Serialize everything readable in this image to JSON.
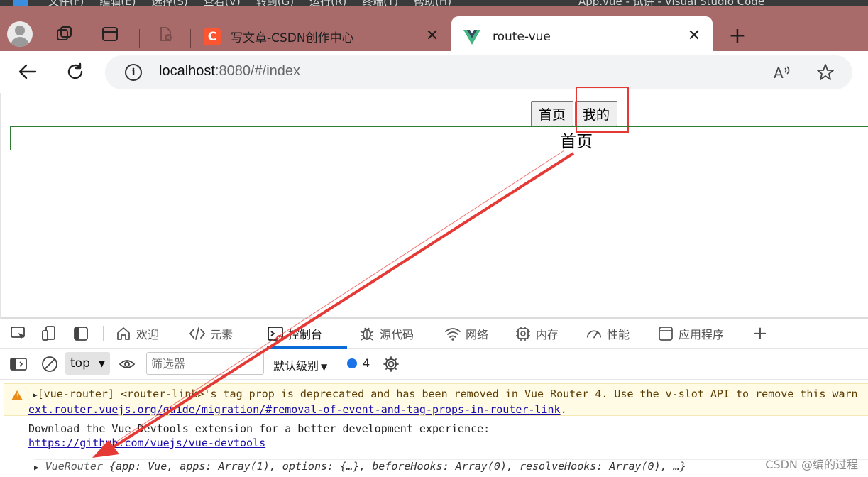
{
  "os": {
    "menu": [
      "文件(F)",
      "编辑(E)",
      "选择(S)",
      "查看(V)",
      "转到(G)",
      "运行(R)",
      "终端(T)",
      "帮助(H)"
    ],
    "title": "App.vue - 试讲 - Visual Studio Code"
  },
  "tabs": [
    {
      "title": "写文章-CSDN创作中心",
      "favicon": "csdn-icon",
      "favicon_letter": "C",
      "active": false
    },
    {
      "title": "route-vue",
      "favicon": "vue-icon",
      "active": true
    }
  ],
  "tab_close_glyph": "✕",
  "new_tab_glyph": "+",
  "address": {
    "host": "localhost",
    "rest": ":8080/#/index",
    "info_glyph": "i"
  },
  "page": {
    "nav_buttons": [
      "首页",
      "我的"
    ],
    "view_title": "首页"
  },
  "devtools": {
    "tabs": [
      {
        "label": "欢迎",
        "icon": "home-icon"
      },
      {
        "label": "元素",
        "icon": "code-icon"
      },
      {
        "label": "控制台",
        "icon": "console-icon",
        "active": true
      },
      {
        "label": "源代码",
        "icon": "bug-icon"
      },
      {
        "label": "网络",
        "icon": "wifi-icon"
      },
      {
        "label": "内存",
        "icon": "chip-icon"
      },
      {
        "label": "性能",
        "icon": "gauge-icon"
      },
      {
        "label": "应用程序",
        "icon": "app-icon"
      }
    ],
    "add_glyph": "+",
    "console": {
      "context": "top",
      "filter_placeholder": "筛选器",
      "levels": "默认级别",
      "message_count": "4",
      "warning_line1": "[vue-router] <router-link>'s tag prop is deprecated and has been removed in Vue Router 4. Use the v-slot API to remove this warn",
      "warning_line2_link": "ext.router.vuejs.org/guide/migration/#removal-of-event-and-tag-props-in-router-link",
      "warning_line2_tail": ".",
      "info_text": "Download the Vue Devtools extension for a better development experience:",
      "info_link": "https://github.com/vuejs/vue-devtools",
      "object_name": "VueRouter",
      "object_preview": "{app: Vue, apps: Array(1), options: {…}, beforeHooks: Array(0), resolveHooks: Array(0), …}"
    }
  },
  "watermark": "CSDN @编的过程",
  "colors": {
    "tabbar": "#a96a6a",
    "annotation": "#e53935",
    "active_tab_underline": "#0a6bd6",
    "warning_bg": "#fffbe5"
  }
}
